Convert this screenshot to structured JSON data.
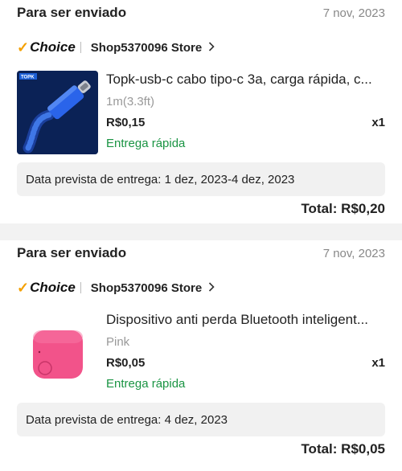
{
  "orders": [
    {
      "status": "Para ser enviado",
      "date": "7 nov, 2023",
      "badge": "Choice",
      "store": "Shop5370096 Store",
      "product_title": "Topk-usb-c cabo tipo-c 3a, carga rápida, c...",
      "variant": "1m(3.3ft)",
      "price": "R$0,15",
      "quantity": "x1",
      "delivery_tag": "Entrega rápida",
      "estimate": "Data prevista de entrega: 1 dez, 2023-4 dez, 2023",
      "total": "Total: R$0,20",
      "thumb_brand": "TOPK"
    },
    {
      "status": "Para ser enviado",
      "date": "7 nov, 2023",
      "badge": "Choice",
      "store": "Shop5370096 Store",
      "product_title": "Dispositivo anti perda Bluetooth inteligent...",
      "variant": "Pink",
      "price": "R$0,05",
      "quantity": "x1",
      "delivery_tag": "Entrega rápida",
      "estimate": "Data prevista de entrega: 4 dez, 2023",
      "total": "Total: R$0,05"
    }
  ],
  "icons": {
    "choice_check": "checkmark-icon",
    "store_arrow": "chevron-right-icon"
  },
  "colors": {
    "accent_orange": "#f4a000",
    "delivery_green": "#1a9443",
    "tracker_pink": "#f2538a"
  }
}
